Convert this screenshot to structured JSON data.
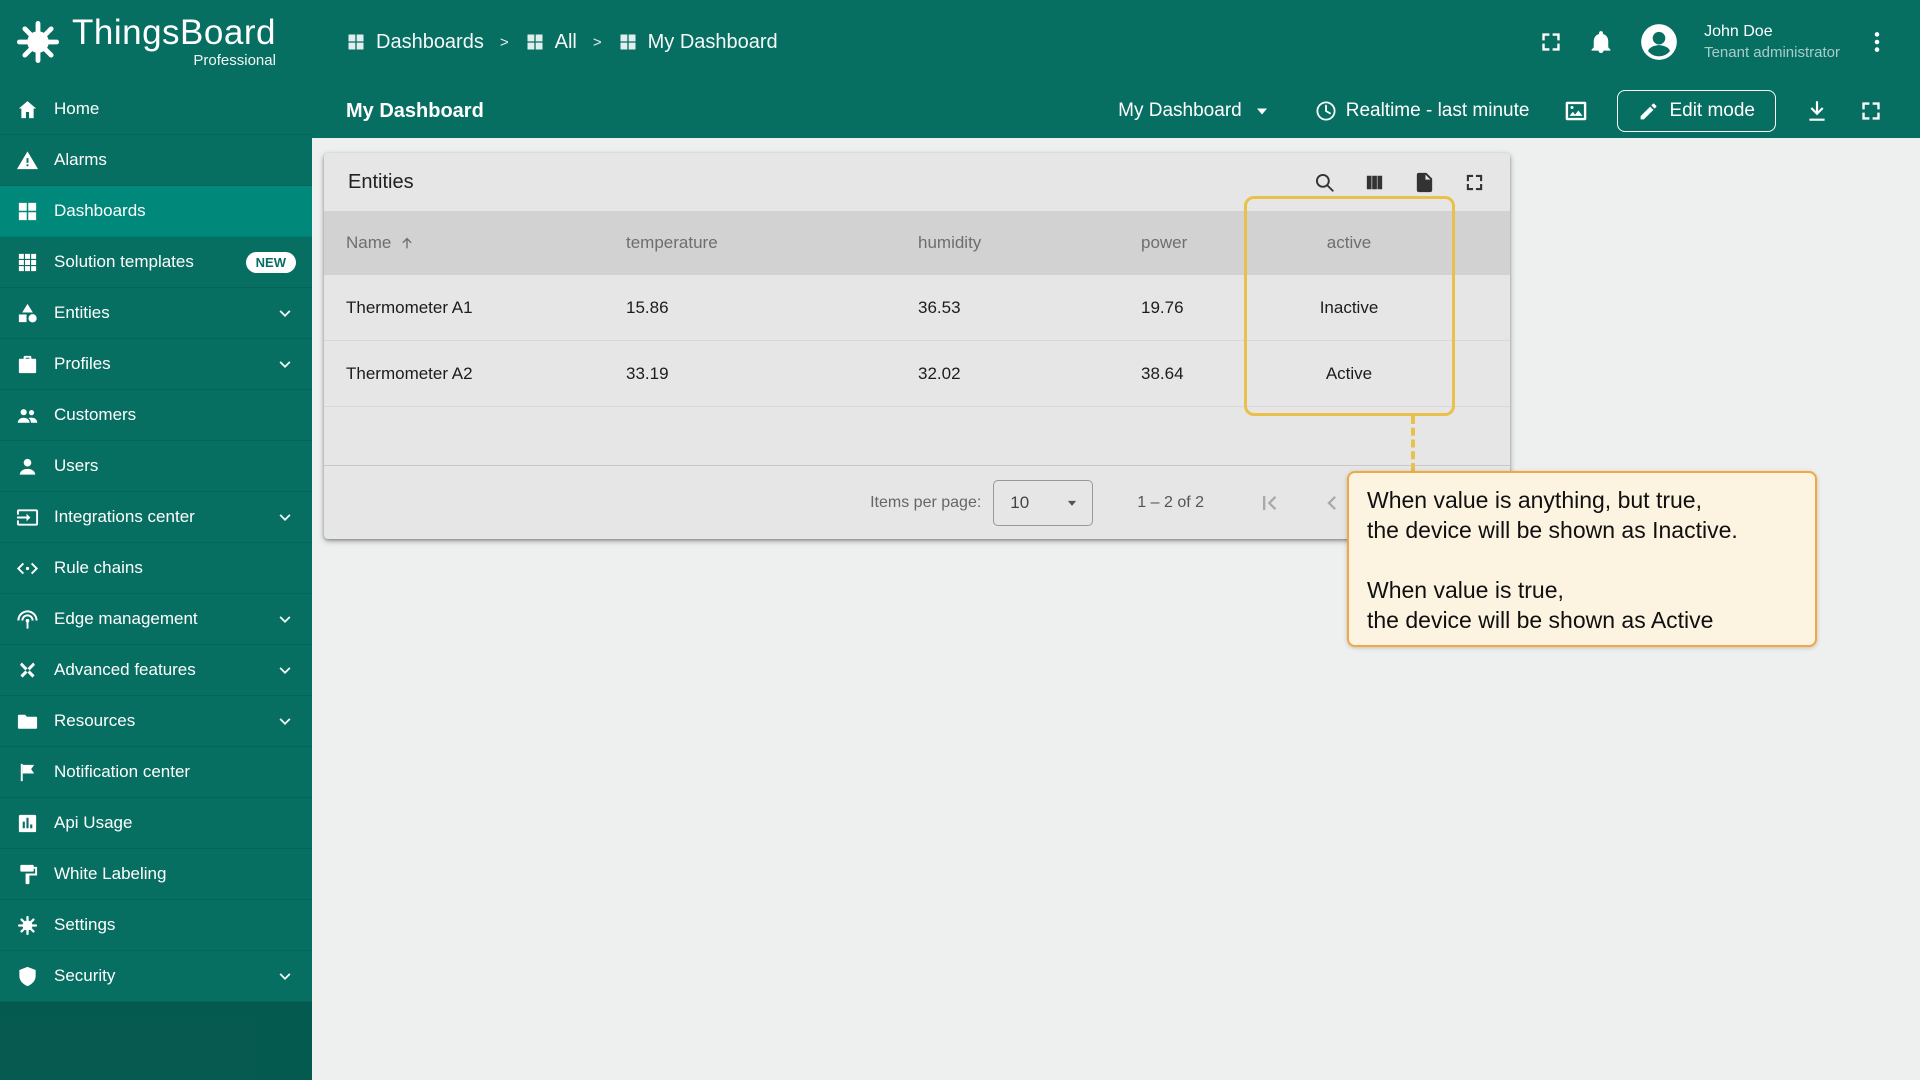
{
  "app": {
    "brand": "ThingsBoard",
    "brand_sub": "Professional"
  },
  "colors": {
    "primary": "#076e62",
    "active_item": "#00897b",
    "highlight_border": "#e8c04a",
    "tooltip_bg": "#fcf3e0",
    "tooltip_border": "#f0a843"
  },
  "sidebar": {
    "items": [
      {
        "label": "Home"
      },
      {
        "label": "Alarms"
      },
      {
        "label": "Dashboards"
      },
      {
        "label": "Solution templates",
        "badge": "NEW"
      },
      {
        "label": "Entities"
      },
      {
        "label": "Profiles"
      },
      {
        "label": "Customers"
      },
      {
        "label": "Users"
      },
      {
        "label": "Integrations center"
      },
      {
        "label": "Rule chains"
      },
      {
        "label": "Edge management"
      },
      {
        "label": "Advanced features"
      },
      {
        "label": "Resources"
      },
      {
        "label": "Notification center"
      },
      {
        "label": "Api Usage"
      },
      {
        "label": "White Labeling"
      },
      {
        "label": "Settings"
      },
      {
        "label": "Security"
      }
    ]
  },
  "header": {
    "separator": ">",
    "breadcrumb": [
      {
        "label": "Dashboards"
      },
      {
        "label": "All"
      },
      {
        "label": "My Dashboard"
      }
    ],
    "user": {
      "name": "John Doe",
      "role": "Tenant administrator"
    }
  },
  "toolbar": {
    "title": "My Dashboard",
    "dashboard_select": "My Dashboard",
    "time_window": "Realtime - last minute",
    "edit_button": "Edit mode"
  },
  "widget": {
    "title": "Entities",
    "table": {
      "columns": [
        "Name",
        "temperature",
        "humidity",
        "power",
        "active"
      ],
      "rows": [
        {
          "name": "Thermometer A1",
          "temperature": "15.86",
          "humidity": "36.53",
          "power": "19.76",
          "active": "Inactive"
        },
        {
          "name": "Thermometer A2",
          "temperature": "33.19",
          "humidity": "32.02",
          "power": "38.64",
          "active": "Active"
        }
      ]
    },
    "pagination": {
      "items_per_page_label": "Items per page:",
      "items_per_page_value": "10",
      "range_label": "1 – 2 of 2"
    }
  },
  "annotation": {
    "tooltip_lines": [
      "When value is anything, but true,",
      "the device will be shown as Inactive.",
      "",
      "When value is true,",
      "the device will be shown as Active"
    ]
  }
}
